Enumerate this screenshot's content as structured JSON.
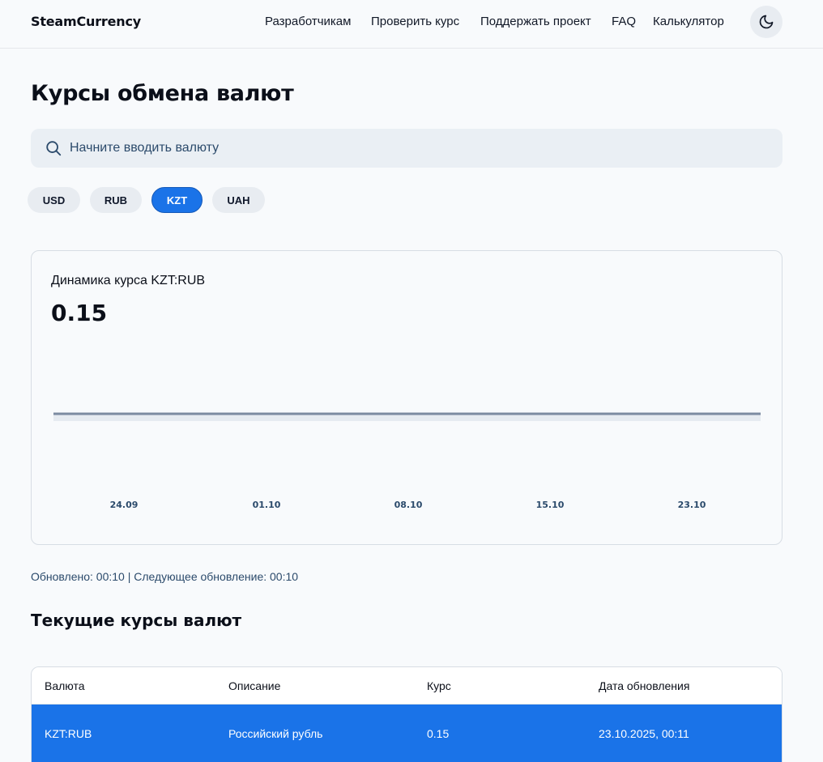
{
  "header": {
    "brand": "SteamCurrency",
    "nav": [
      "Разработчикам",
      "Проверить курс",
      "Поддержать проект",
      "FAQ",
      "Калькулятор"
    ],
    "theme_icon": "moon-icon"
  },
  "page_title": "Курсы обмена валют",
  "search": {
    "placeholder": "Начните вводить валюту",
    "icon": "search-icon"
  },
  "currency_chips": [
    {
      "label": "USD",
      "active": false
    },
    {
      "label": "RUB",
      "active": false
    },
    {
      "label": "KZT",
      "active": true
    },
    {
      "label": "UAH",
      "active": false
    }
  ],
  "chart_card": {
    "title": "Динамика курса KZT:RUB",
    "current_value": "0.15"
  },
  "chart_data": {
    "type": "area",
    "title": "Динамика курса KZT:RUB",
    "xlabel": "",
    "ylabel": "",
    "x_ticks": [
      "24.09",
      "01.10",
      "08.10",
      "15.10",
      "23.10"
    ],
    "series": [
      {
        "values": [
          0.15,
          0.15,
          0.15,
          0.15,
          0.15
        ]
      }
    ],
    "grid": false,
    "line_color": "#7c8ba1"
  },
  "updated_text": "Обновлено: 00:10 | Следующее обновление: 00:10",
  "section_title": "Текущие курсы валют",
  "table": {
    "headers": [
      "Валюта",
      "Описание",
      "Курс",
      "Дата обновления"
    ],
    "rows": [
      [
        "KZT:RUB",
        "Российский рубль",
        "0.15",
        "23.10.2025, 00:11"
      ]
    ]
  },
  "colors": {
    "accent": "#1a73e8",
    "background": "#f8fafc"
  }
}
